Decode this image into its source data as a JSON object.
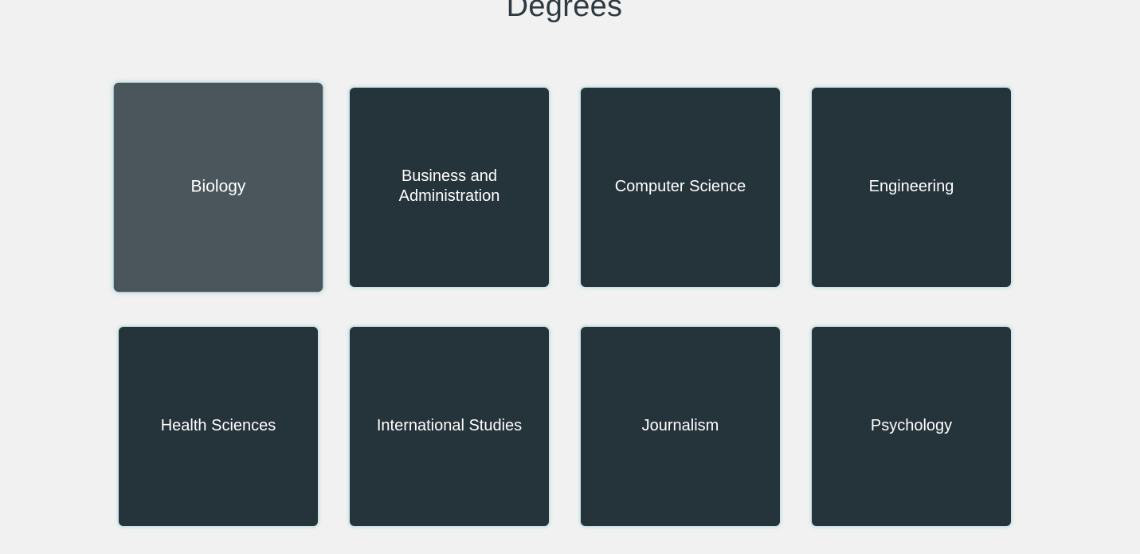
{
  "header": {
    "title": "Degrees"
  },
  "colors": {
    "background": "#f1f1f1",
    "card": "#25333a",
    "card_hover": "#4a565c",
    "card_text": "#ffffff",
    "title_text": "#2e3a40"
  },
  "degrees": [
    {
      "label": "Biology",
      "state": "hovered"
    },
    {
      "label": "Business and Administration"
    },
    {
      "label": "Computer Science"
    },
    {
      "label": "Engineering"
    },
    {
      "label": "Health Sciences"
    },
    {
      "label": "International Studies"
    },
    {
      "label": "Journalism"
    },
    {
      "label": "Psychology"
    }
  ]
}
